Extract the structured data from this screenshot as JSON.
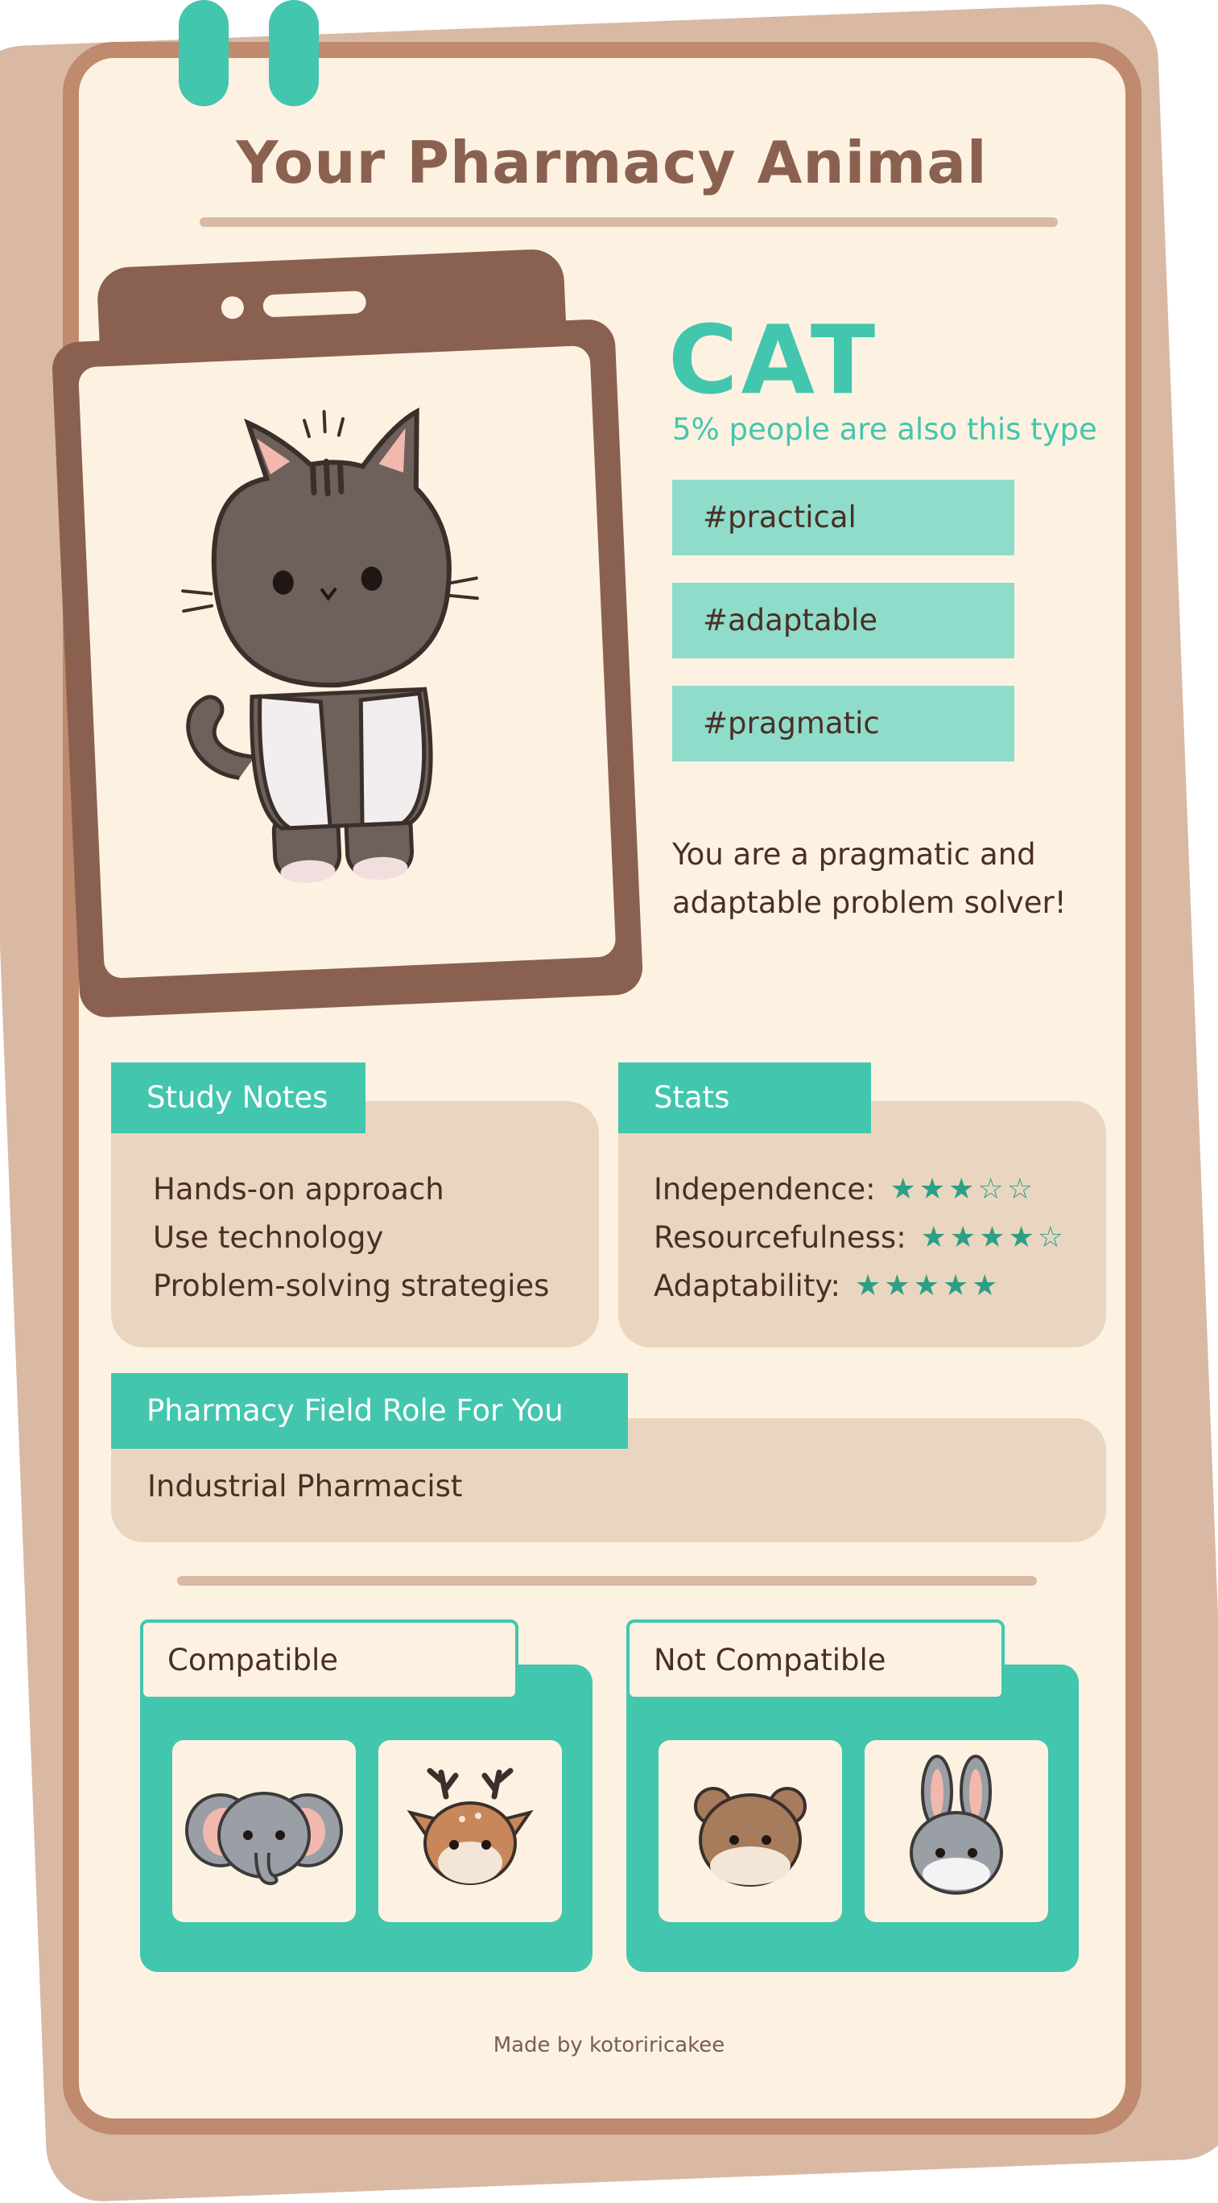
{
  "header": {
    "title": "Your Pharmacy Animal"
  },
  "result": {
    "animal": "CAT",
    "percent_text": "5% people are also this type",
    "tags": [
      "#practical",
      "#adaptable",
      "#pragmatic"
    ],
    "description": "You are a pragmatic and adaptable problem solver!",
    "portrait_icon": "cat-in-lab-coat-icon"
  },
  "study_notes": {
    "label": "Study Notes",
    "items": [
      "Hands-on approach",
      "Use technology",
      "Problem-solving strategies"
    ]
  },
  "stats": {
    "label": "Stats",
    "items": [
      {
        "name": "Independence:",
        "rating": 3,
        "max": 5
      },
      {
        "name": "Resourcefulness:",
        "rating": 4,
        "max": 5
      },
      {
        "name": "Adaptability:",
        "rating": 5,
        "max": 5
      }
    ]
  },
  "role": {
    "label": "Pharmacy Field Role For You",
    "value": "Industrial Pharmacist"
  },
  "compatible": {
    "label": "Compatible",
    "animals": [
      "elephant-icon",
      "deer-icon"
    ]
  },
  "not_compatible": {
    "label": "Not Compatible",
    "animals": [
      "bear-icon",
      "rabbit-icon"
    ]
  },
  "footer": {
    "credit": "Made by kotoriricakee"
  },
  "colors": {
    "accent": "#43c6ae",
    "tag_bg": "#8fdccb",
    "brown": "#8a6150",
    "card_bg": "#fdf2e1",
    "panel_bg": "#ead6c0",
    "border": "#bf8a6e"
  }
}
